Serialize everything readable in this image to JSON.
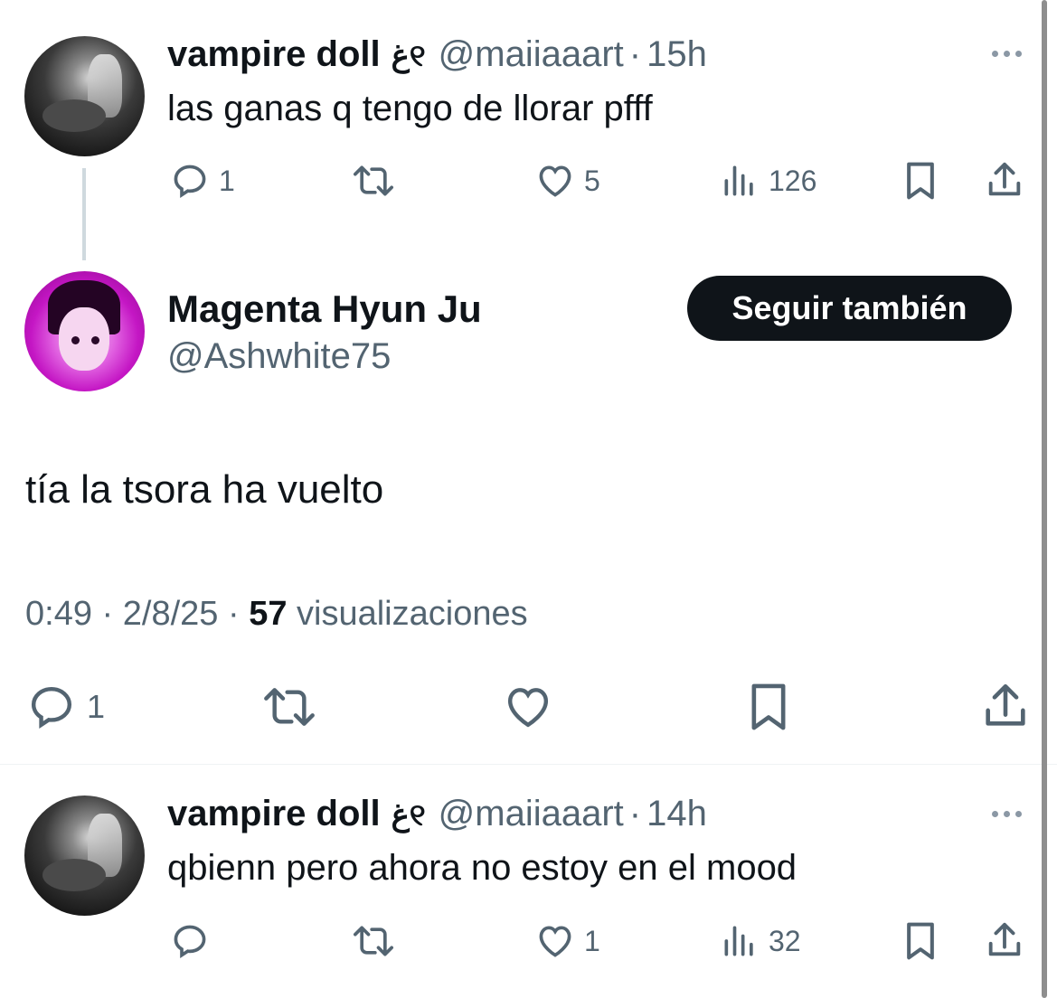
{
  "tweets": [
    {
      "name": "vampire doll",
      "glyph": "ﻍ୧",
      "handle": "@maiiaaart",
      "separator": "·",
      "time": "15h",
      "text": "las ganas q tengo de llorar pfff",
      "stats": {
        "replies": "1",
        "retweets": "",
        "likes": "5",
        "views": "126"
      }
    },
    {
      "name": "vampire doll",
      "glyph": "ﻍ୧",
      "handle": "@maiiaaart",
      "separator": "·",
      "time": "14h",
      "text": "qbienn pero ahora no estoy en el mood",
      "stats": {
        "replies": "",
        "retweets": "",
        "likes": "1",
        "views": "32"
      }
    }
  ],
  "main_tweet": {
    "name": "Magenta Hyun Ju",
    "handle": "@Ashwhite75",
    "follow_label": "Seguir también",
    "text": "tía la tsora ha vuelto",
    "time": "0:49",
    "date": "2/8/25",
    "separator": "·",
    "views_count": "57",
    "views_label": "visualizaciones",
    "reply_count": "1"
  },
  "icons": {
    "reply": "reply-icon",
    "retweet": "retweet-icon",
    "like": "heart-icon",
    "views": "views-icon",
    "bookmark": "bookmark-icon",
    "share": "share-icon",
    "more": "more-icon"
  },
  "colors": {
    "text": "#0f1419",
    "secondary": "#536471",
    "button_bg": "#0f1419",
    "button_text": "#ffffff",
    "thread_line": "#cfd9de"
  }
}
